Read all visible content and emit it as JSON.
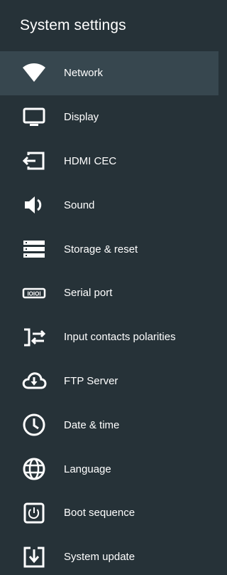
{
  "header": {
    "title": "System settings"
  },
  "colors": {
    "background": "#263238",
    "selected_background": "#37474f",
    "text": "#ffffff"
  },
  "menu": {
    "items": [
      {
        "label": "Network",
        "icon": "wifi-icon",
        "selected": true
      },
      {
        "label": "Display",
        "icon": "monitor-icon",
        "selected": false
      },
      {
        "label": "HDMI CEC",
        "icon": "hdmi-input-icon",
        "selected": false
      },
      {
        "label": "Sound",
        "icon": "speaker-icon",
        "selected": false
      },
      {
        "label": "Storage & reset",
        "icon": "storage-icon",
        "selected": false
      },
      {
        "label": "Serial port",
        "icon": "serial-port-icon",
        "selected": false
      },
      {
        "label": "Input contacts polarities",
        "icon": "swap-arrows-icon",
        "selected": false
      },
      {
        "label": "FTP Server",
        "icon": "cloud-download-icon",
        "selected": false
      },
      {
        "label": "Date & time",
        "icon": "clock-icon",
        "selected": false
      },
      {
        "label": "Language",
        "icon": "globe-icon",
        "selected": false
      },
      {
        "label": "Boot sequence",
        "icon": "power-icon",
        "selected": false
      },
      {
        "label": "System update",
        "icon": "system-update-icon",
        "selected": false
      }
    ]
  }
}
